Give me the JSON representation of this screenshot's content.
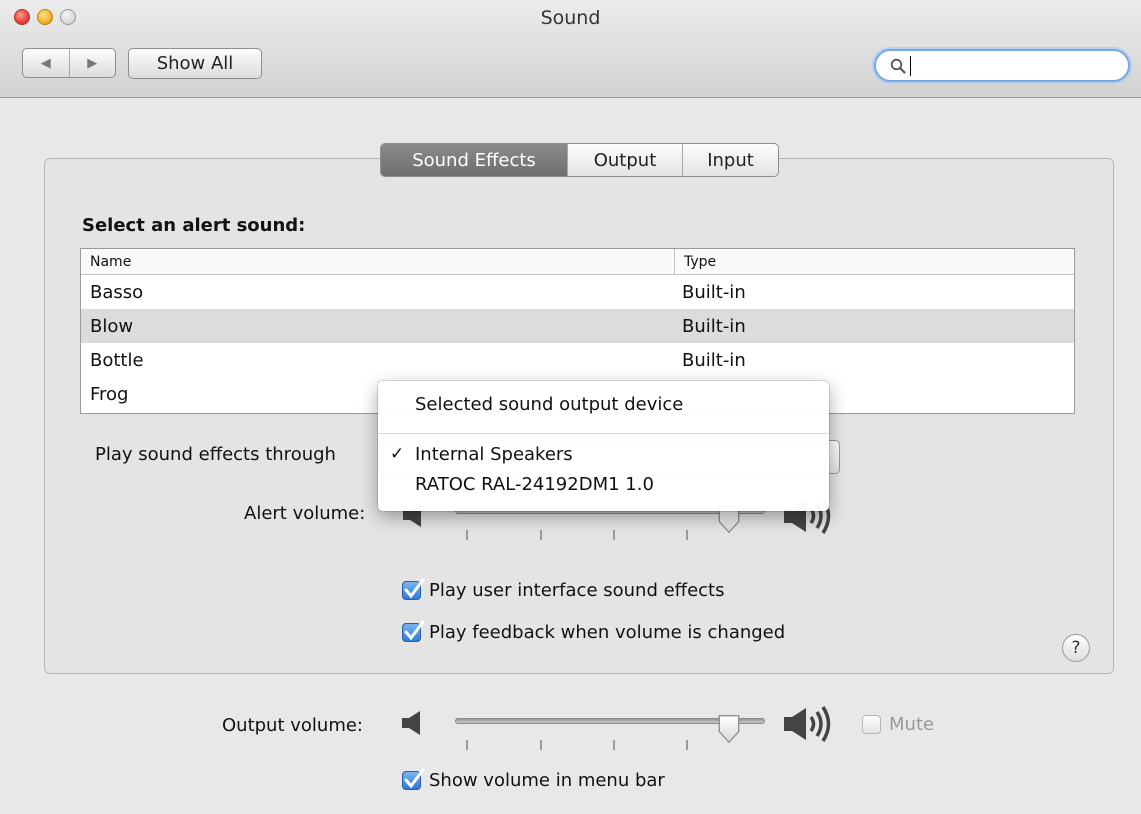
{
  "window": {
    "title": "Sound"
  },
  "toolbar": {
    "back_label": "◀",
    "forward_label": "▶",
    "show_all_label": "Show All",
    "search_value": ""
  },
  "tabs": [
    {
      "label": "Sound Effects",
      "selected": true
    },
    {
      "label": "Output",
      "selected": false
    },
    {
      "label": "Input",
      "selected": false
    }
  ],
  "sound_effects": {
    "heading": "Select an alert sound:",
    "columns": [
      "Name",
      "Type"
    ],
    "rows": [
      {
        "name": "Basso",
        "type": "Built-in",
        "selected": false
      },
      {
        "name": "Blow",
        "type": "Built-in",
        "selected": true
      },
      {
        "name": "Bottle",
        "type": "Built-in",
        "selected": false
      },
      {
        "name": "Frog",
        "type": "",
        "selected": false
      }
    ],
    "play_through_label": "Play sound effects through",
    "alert_volume_label": "Alert volume:",
    "alert_volume_level": 0.92,
    "checkbox_ui_sounds": {
      "label": "Play user interface sound effects",
      "checked": true
    },
    "checkbox_feedback": {
      "label": "Play feedback when volume is changed",
      "checked": true
    },
    "help_label": "?"
  },
  "dropdown": {
    "title": "Selected sound output device",
    "items": [
      {
        "label": "Internal Speakers",
        "checked": true,
        "check_glyph": "✓"
      },
      {
        "label": "RATOC RAL-24192DM1 1.0",
        "checked": false
      }
    ]
  },
  "output": {
    "volume_label": "Output volume:",
    "volume_level": 0.92,
    "mute_label": "Mute",
    "mute_checked": false,
    "show_volume_label": "Show volume in menu bar",
    "show_volume_checked": true
  },
  "colors": {
    "selected_tab": "#7a7a7a",
    "checkbox_blue": "#3a85dc",
    "search_focus": "#7aa7de"
  },
  "icons": [
    "speaker-low-icon",
    "speaker-high-icon",
    "search-icon",
    "checkmark-icon",
    "help-icon"
  ]
}
